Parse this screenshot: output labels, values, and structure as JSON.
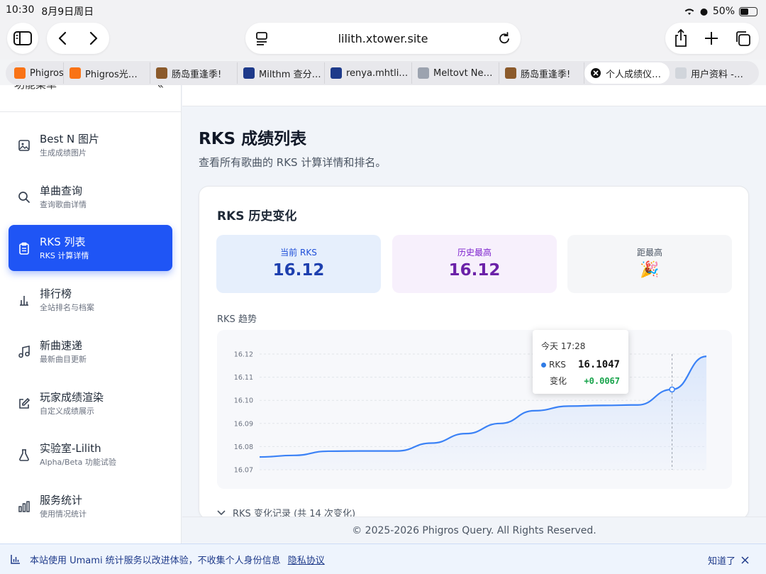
{
  "status": {
    "time": "10:30",
    "date": "8月9日周日",
    "battery": "50%"
  },
  "browser": {
    "url": "lilith.xtower.site",
    "tabs": [
      {
        "label": "Phigros",
        "favicon_color": "#f97316"
      },
      {
        "label": "Phigros光…",
        "favicon_color": "#f97316"
      },
      {
        "label": "肠岛重逢季!",
        "favicon_color": "#8b5a2b"
      },
      {
        "label": "Milthm 查分…",
        "favicon_color": "#1e3a8a"
      },
      {
        "label": "renya.mhtli…",
        "favicon_color": "#1e3a8a"
      },
      {
        "label": "Meltovt Ne…",
        "favicon_color": "#9ca3af"
      },
      {
        "label": "肠岛重逢季!",
        "favicon_color": "#8b5a2b"
      },
      {
        "label": "个人成绩仪…",
        "favicon_color": "#111111"
      },
      {
        "label": "用户资料 -…",
        "favicon_color": "#d1d5db"
      }
    ]
  },
  "sidebar": {
    "header": "功能菜单",
    "items": [
      {
        "title": "Best N 图片",
        "subtitle": "生成成绩图片",
        "icon": "image-icon"
      },
      {
        "title": "单曲查询",
        "subtitle": "查询歌曲详情",
        "icon": "search-icon"
      },
      {
        "title": "RKS 列表",
        "subtitle": "RKS 计算详情",
        "icon": "clipboard-icon"
      },
      {
        "title": "排行榜",
        "subtitle": "全站排名与档案",
        "icon": "leaderboard-icon"
      },
      {
        "title": "新曲速递",
        "subtitle": "最新曲目更新",
        "icon": "music-icon"
      },
      {
        "title": "玩家成绩渲染",
        "subtitle": "自定义成绩展示",
        "icon": "edit-icon"
      },
      {
        "title": "实验室-Lilith",
        "subtitle": "Alpha/Beta 功能试验",
        "icon": "flask-icon"
      },
      {
        "title": "服务统计",
        "subtitle": "使用情况统计",
        "icon": "bar-chart-icon"
      }
    ]
  },
  "main": {
    "title": "RKS 成绩列表",
    "description": "查看所有歌曲的 RKS 计算详情和排名。",
    "card_title": "RKS 历史变化",
    "stats": [
      {
        "label": "当前 RKS",
        "value": "16.12"
      },
      {
        "label": "历史最高",
        "value": "16.12"
      },
      {
        "label": "距最高",
        "value": "🎉"
      }
    ],
    "trend_label": "RKS 趋势",
    "tooltip": {
      "time": "今天 17:28",
      "series": "RKS",
      "value": "16.1047",
      "change_label": "变化",
      "change": "+0.0067"
    },
    "records_label": "RKS 变化记录 (共 14 次变化)"
  },
  "chart_data": {
    "type": "area",
    "y_ticks": [
      "16.12",
      "16.11",
      "16.10",
      "16.09",
      "16.08",
      "16.07"
    ],
    "ylim": [
      16.07,
      16.12
    ],
    "x": [
      0,
      1,
      2,
      3,
      4,
      5,
      6,
      7,
      8,
      9,
      10,
      11,
      12,
      13
    ],
    "series": [
      {
        "name": "RKS",
        "values": [
          16.0755,
          16.0762,
          16.078,
          16.0781,
          16.0781,
          16.0815,
          16.0856,
          16.09,
          16.0955,
          16.0975,
          16.0978,
          16.098,
          16.1047,
          16.119
        ]
      }
    ],
    "highlight_index": 12,
    "grid": true,
    "colors": {
      "line": "#3b82f6",
      "area": "#dbe7fb"
    }
  },
  "footer": "© 2025-2026 Phigros Query. All Rights Reserved.",
  "consent": {
    "text": "本站使用 Umami 统计服务以改进体验，不收集个人身份信息",
    "link": "隐私协议",
    "ok": "知道了"
  }
}
